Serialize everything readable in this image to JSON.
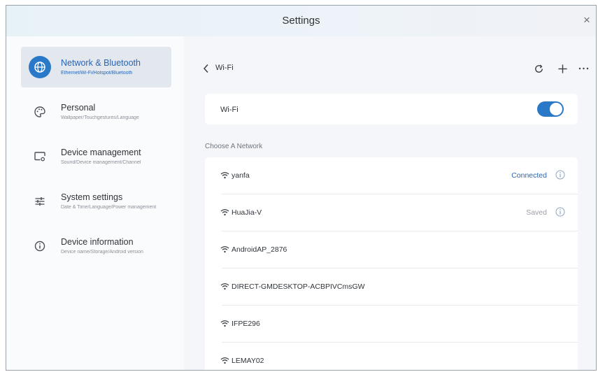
{
  "window": {
    "title": "Settings",
    "close_icon": "×"
  },
  "sidebar": {
    "items": [
      {
        "title": "Network & Bluetooth",
        "subtitle": "Ethernet/Wi-Fi/Hotspot/Bluetooth",
        "icon": "globe-icon",
        "active": true
      },
      {
        "title": "Personal",
        "subtitle": "Wallpaper/Touchgestures/Language",
        "icon": "palette-icon",
        "active": false
      },
      {
        "title": "Device management",
        "subtitle": "Sound/Device management/Channel",
        "icon": "monitor-icon",
        "active": false
      },
      {
        "title": "System settings",
        "subtitle": "Date & Time/Language/Power management",
        "icon": "sliders-icon",
        "active": false
      },
      {
        "title": "Device information",
        "subtitle": "Device name/Storage/Android version",
        "icon": "info-icon",
        "active": false
      }
    ]
  },
  "main": {
    "page_title": "Wi-Fi",
    "back_icon": "chevron-left-icon",
    "toolbar": {
      "refresh_icon": "refresh-icon",
      "add_icon": "plus-icon",
      "more_icon": "more-icon"
    },
    "wifi_toggle": {
      "label": "Wi-Fi",
      "on": true
    },
    "section_label": "Choose A Network",
    "networks": [
      {
        "name": "yanfa",
        "status": "Connected",
        "info": true
      },
      {
        "name": "HuaJia-V",
        "status": "Saved",
        "info": true
      },
      {
        "name": "AndroidAP_2876",
        "status": "",
        "info": false
      },
      {
        "name": "DIRECT-GMDESKTOP-ACBPIVCmsGW",
        "status": "",
        "info": false
      },
      {
        "name": "IFPE296",
        "status": "",
        "info": false
      },
      {
        "name": "LEMAY02",
        "status": "",
        "info": false
      }
    ]
  },
  "colors": {
    "accent": "#2a79c9",
    "connected": "#2a64b3",
    "saved": "#9aa0a6"
  }
}
